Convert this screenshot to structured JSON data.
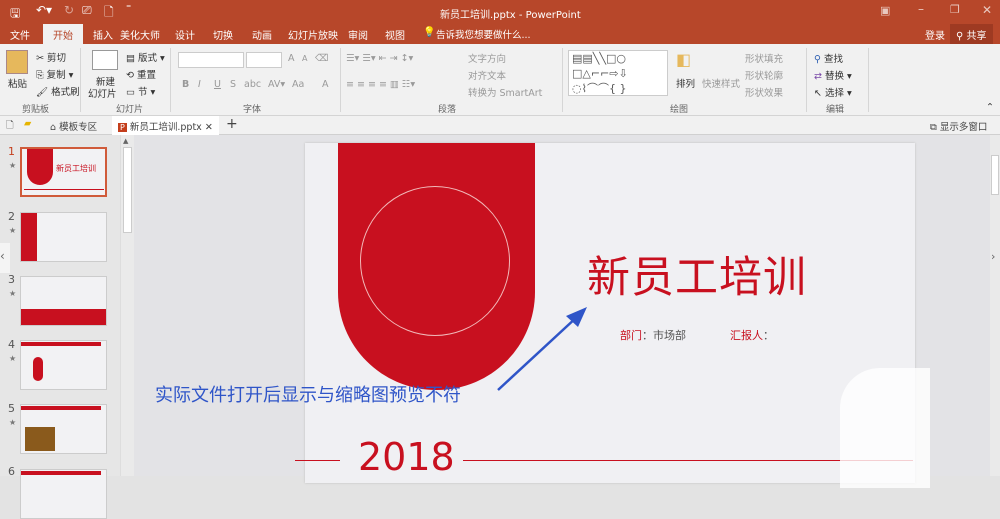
{
  "window": {
    "title": "新员工培训.pptx - PowerPoint"
  },
  "tabs": [
    "文件",
    "开始",
    "插入",
    "美化大师",
    "设计",
    "切换",
    "动画",
    "幻灯片放映",
    "审阅",
    "视图"
  ],
  "tell_me": "告诉我您想要做什么...",
  "login": "登录",
  "share": "共享",
  "ribbon": {
    "clipboard": {
      "paste": "粘贴",
      "cut": "剪切",
      "copy": "复制",
      "format_painter": "格式刷",
      "label": "剪贴板"
    },
    "slides": {
      "new_slide": "新建",
      "new_slide2": "幻灯片",
      "layout": "版式",
      "reset": "重置",
      "section": "节",
      "label": "幻灯片"
    },
    "font": {
      "label": "字体",
      "bold": "B",
      "italic": "I",
      "underline": "U",
      "strike": "S",
      "grow": "A",
      "shrink": "A",
      "case": "Aa",
      "color": "A"
    },
    "paragraph": {
      "label": "段落",
      "text_direction": "文字方向",
      "align_text": "对齐文本",
      "smartart": "转换为 SmartArt"
    },
    "drawing": {
      "label": "绘图",
      "arrange": "排列",
      "quick_styles": "快速样式",
      "fill": "形状填充",
      "outline": "形状轮廓",
      "effects": "形状效果"
    },
    "editing": {
      "label": "编辑",
      "find": "查找",
      "replace": "替换",
      "select": "选择"
    }
  },
  "doc_tabs": {
    "template": "模板专区",
    "file": "新员工培训.pptx",
    "multi_window": "显示多窗口"
  },
  "thumbnails": [
    {
      "n": "1"
    },
    {
      "n": "2"
    },
    {
      "n": "3"
    },
    {
      "n": "4"
    },
    {
      "n": "5"
    },
    {
      "n": "6"
    }
  ],
  "slide": {
    "title": "新员工培训",
    "dept_label": "部门",
    "dept_value": "：市场部",
    "reporter_label": "汇报人",
    "reporter_value": "：",
    "year": "2018"
  },
  "annotation": "实际文件打开后显示与缩略图预览不符",
  "colors": {
    "brand": "#b7472a",
    "slide_red": "#c8101f",
    "annotation": "#2f55c8"
  }
}
